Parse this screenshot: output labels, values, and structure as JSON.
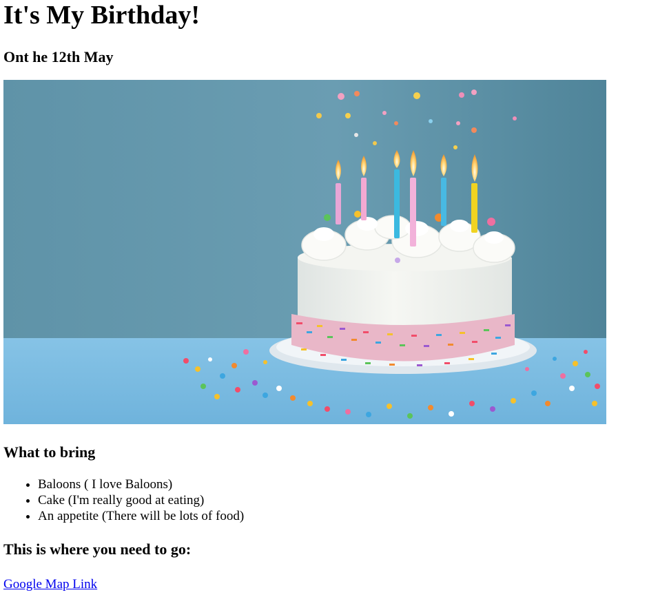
{
  "header": {
    "title": "It's My Birthday!",
    "date_line": "Ont he 12th May"
  },
  "hero_image": {
    "icon": "birthday-cake-image",
    "colors": {
      "wall": "#5f93a8",
      "table": "#7cbbe0",
      "frosting": "#f3f4f0",
      "plate": "#e9eef2"
    }
  },
  "bring": {
    "heading": "What to bring",
    "items": [
      {
        "text": "Baloons ( I love Baloons)"
      },
      {
        "text": "Cake (I'm really good at eating)"
      },
      {
        "text": "An appetite (There will be lots of food)"
      }
    ]
  },
  "directions": {
    "heading": "This is where you need to go:",
    "link_label": "Google Map Link",
    "link_color": "#0000ee"
  }
}
